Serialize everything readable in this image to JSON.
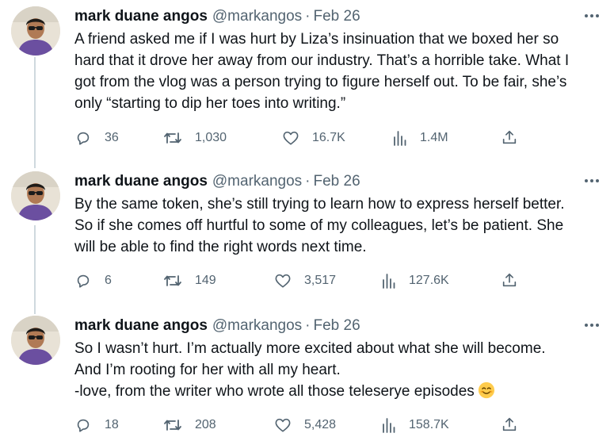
{
  "tweets": [
    {
      "name": "mark duane angos",
      "handle": "@markangos",
      "separator": "·",
      "date": "Feb 26",
      "lines": [
        "A friend asked me if I was hurt by Liza’s insinuation that we boxed her so",
        "hard that it drove her away from our industry. That’s a horrible take. What I",
        "got from the vlog was a person trying to figure herself out. To be fair, she’s",
        "only “starting to dip her toes into writing.”"
      ],
      "replies": "36",
      "retweets": "1,030",
      "likes": "16.7K",
      "views": "1.4M"
    },
    {
      "name": "mark duane angos",
      "handle": "@markangos",
      "separator": "·",
      "date": "Feb 26",
      "lines": [
        "By the same token, she’s still trying to learn how to express herself better.",
        "So if she comes off hurtful to some of my colleagues, let’s be patient. She",
        "will be able to find the right words next time."
      ],
      "replies": "6",
      "retweets": "149",
      "likes": "3,517",
      "views": "127.6K"
    },
    {
      "name": "mark duane angos",
      "handle": "@markangos",
      "separator": "·",
      "date": "Feb 26",
      "lines": [
        "So I wasn’t hurt. I’m actually more excited about what she will become.",
        "And I’m rooting for her with all my heart.",
        "-love, from the writer who wrote all those teleserye episodes"
      ],
      "emoji": "smiling-face-emoji",
      "replies": "18",
      "retweets": "208",
      "likes": "5,428",
      "views": "158.7K"
    }
  ],
  "icons": {
    "more": "more-horizontal-icon",
    "reply": "reply-icon",
    "retweet": "retweet-icon",
    "like": "heart-icon",
    "views": "views-chart-icon",
    "share": "share-icon"
  },
  "colors": {
    "text": "#0f1419",
    "secondary": "#536471",
    "thread_line": "#cfd9de"
  }
}
